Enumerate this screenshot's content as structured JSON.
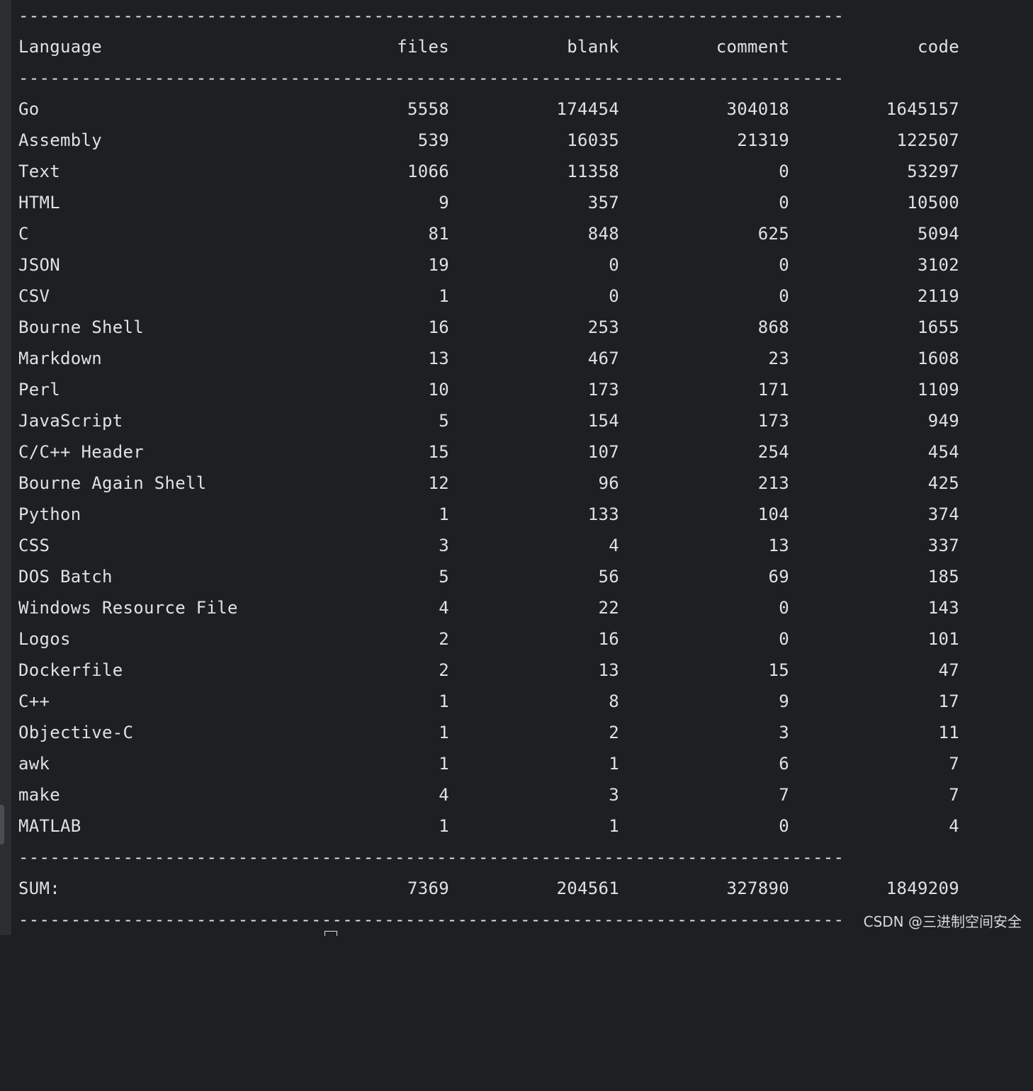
{
  "separator": "-------------------------------------------------------------------------------",
  "header": {
    "language": "Language",
    "files": "files",
    "blank": "blank",
    "comment": "comment",
    "code": "code"
  },
  "rows": [
    {
      "language": "Go",
      "files": "5558",
      "blank": "174454",
      "comment": "304018",
      "code": "1645157"
    },
    {
      "language": "Assembly",
      "files": "539",
      "blank": "16035",
      "comment": "21319",
      "code": "122507"
    },
    {
      "language": "Text",
      "files": "1066",
      "blank": "11358",
      "comment": "0",
      "code": "53297"
    },
    {
      "language": "HTML",
      "files": "9",
      "blank": "357",
      "comment": "0",
      "code": "10500"
    },
    {
      "language": "C",
      "files": "81",
      "blank": "848",
      "comment": "625",
      "code": "5094"
    },
    {
      "language": "JSON",
      "files": "19",
      "blank": "0",
      "comment": "0",
      "code": "3102"
    },
    {
      "language": "CSV",
      "files": "1",
      "blank": "0",
      "comment": "0",
      "code": "2119"
    },
    {
      "language": "Bourne Shell",
      "files": "16",
      "blank": "253",
      "comment": "868",
      "code": "1655"
    },
    {
      "language": "Markdown",
      "files": "13",
      "blank": "467",
      "comment": "23",
      "code": "1608"
    },
    {
      "language": "Perl",
      "files": "10",
      "blank": "173",
      "comment": "171",
      "code": "1109"
    },
    {
      "language": "JavaScript",
      "files": "5",
      "blank": "154",
      "comment": "173",
      "code": "949"
    },
    {
      "language": "C/C++ Header",
      "files": "15",
      "blank": "107",
      "comment": "254",
      "code": "454"
    },
    {
      "language": "Bourne Again Shell",
      "files": "12",
      "blank": "96",
      "comment": "213",
      "code": "425"
    },
    {
      "language": "Python",
      "files": "1",
      "blank": "133",
      "comment": "104",
      "code": "374"
    },
    {
      "language": "CSS",
      "files": "3",
      "blank": "4",
      "comment": "13",
      "code": "337"
    },
    {
      "language": "DOS Batch",
      "files": "5",
      "blank": "56",
      "comment": "69",
      "code": "185"
    },
    {
      "language": "Windows Resource File",
      "files": "4",
      "blank": "22",
      "comment": "0",
      "code": "143"
    },
    {
      "language": "Logos",
      "files": "2",
      "blank": "16",
      "comment": "0",
      "code": "101"
    },
    {
      "language": "Dockerfile",
      "files": "2",
      "blank": "13",
      "comment": "15",
      "code": "47"
    },
    {
      "language": "C++",
      "files": "1",
      "blank": "8",
      "comment": "9",
      "code": "17"
    },
    {
      "language": "Objective-C",
      "files": "1",
      "blank": "2",
      "comment": "3",
      "code": "11"
    },
    {
      "language": "awk",
      "files": "1",
      "blank": "1",
      "comment": "6",
      "code": "7"
    },
    {
      "language": "make",
      "files": "4",
      "blank": "3",
      "comment": "7",
      "code": "7"
    },
    {
      "language": "MATLAB",
      "files": "1",
      "blank": "1",
      "comment": "0",
      "code": "4"
    }
  ],
  "sum": {
    "label": "SUM:",
    "files": "7369",
    "blank": "204561",
    "comment": "327890",
    "code": "1849209"
  },
  "watermark": "CSDN @三进制空间安全"
}
